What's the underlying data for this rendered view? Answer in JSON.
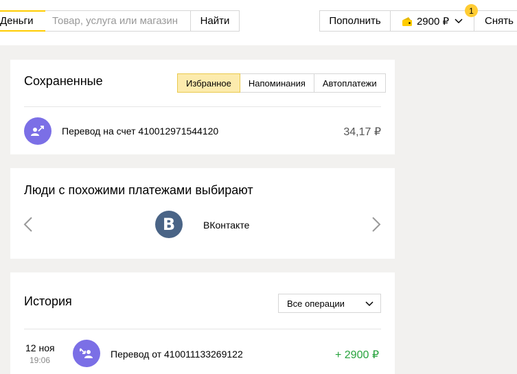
{
  "header": {
    "brand": "Деньги",
    "search_placeholder": "Товар, услуга или магазин",
    "search_button": "Найти",
    "topup_button": "Пополнить",
    "balance": "2900 ₽",
    "withdraw_button": "Снять",
    "notification_count": "1"
  },
  "saved": {
    "title": "Сохраненные",
    "tabs": [
      {
        "label": "Избранное",
        "active": true
      },
      {
        "label": "Напоминания",
        "active": false
      },
      {
        "label": "Автоплатежи",
        "active": false
      }
    ],
    "items": [
      {
        "label": "Перевод на счет 410012971544120",
        "amount": "34,17 ₽",
        "icon": "transfer-out-icon"
      }
    ]
  },
  "people": {
    "title": "Люди с похожими платежами выбирают",
    "service_name": "ВКонтакте",
    "service_logo_letter": "B",
    "service_icon": "vk-logo-icon"
  },
  "history": {
    "title": "История",
    "filter_value": "Все операции",
    "operations": [
      {
        "day": "12 ноя",
        "time": "19:06",
        "label": "Перевод от 410011133269122",
        "amount": "+ 2900 ₽",
        "icon": "transfer-in-icon"
      }
    ]
  },
  "colors": {
    "accent_yellow": "#ffcc00",
    "active_tab_bg": "#fcebad",
    "avatar_purple": "#7b6fe6",
    "income_green": "#27a33d",
    "vk_blue": "#4a6486"
  }
}
